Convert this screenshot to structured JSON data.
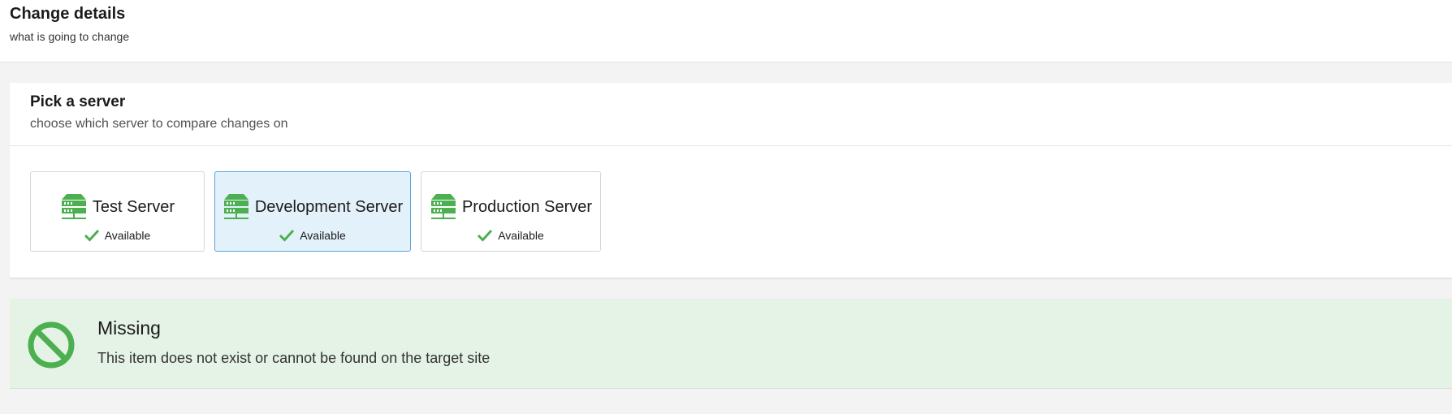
{
  "header": {
    "title": "Change details",
    "subtitle": "what is going to change"
  },
  "server_picker": {
    "title": "Pick a server",
    "subtitle": "choose which server to compare changes on",
    "servers": [
      {
        "name": "Test Server",
        "status": "Available",
        "selected": false,
        "icon": "server-icon",
        "status_icon": "check-icon"
      },
      {
        "name": "Development Server",
        "status": "Available",
        "selected": true,
        "icon": "server-icon",
        "status_icon": "check-icon"
      },
      {
        "name": "Production Server",
        "status": "Available",
        "selected": false,
        "icon": "server-icon",
        "status_icon": "check-icon"
      }
    ]
  },
  "result": {
    "icon": "no-entry-icon",
    "title": "Missing",
    "message": "This item does not exist or cannot be found on the target site"
  },
  "colors": {
    "accent_green": "#4caf50",
    "selected_background": "#e3f1fb",
    "selected_border": "#5ba7df",
    "banner_background": "#e5f2e6"
  }
}
